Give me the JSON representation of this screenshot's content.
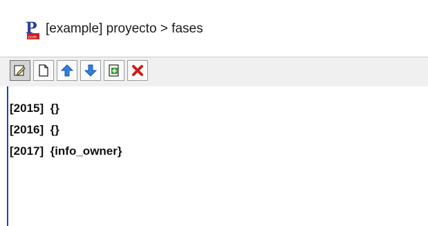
{
  "window": {
    "title": "[example] proyecto > fases",
    "app_icon": "app-logo-icon"
  },
  "toolbar": {
    "buttons": [
      {
        "icon": "edit-icon",
        "pressed": true
      },
      {
        "icon": "new-document-icon",
        "pressed": false
      },
      {
        "icon": "arrow-up-icon",
        "pressed": false
      },
      {
        "icon": "arrow-down-icon",
        "pressed": false
      },
      {
        "icon": "add-item-icon",
        "pressed": false
      },
      {
        "icon": "delete-icon",
        "pressed": false
      }
    ]
  },
  "phases": {
    "items": [
      {
        "label": "[2015]  {}"
      },
      {
        "label": "[2016]  {}"
      },
      {
        "label": "[2017]  {info_owner}"
      }
    ]
  },
  "colors": {
    "toolbar_bg": "#f0f0f0",
    "arrow_blue": "#2f7fe0",
    "delete_red": "#d11a1a",
    "add_green": "#2f9a2f",
    "selection_rule": "#1f3fbf"
  }
}
